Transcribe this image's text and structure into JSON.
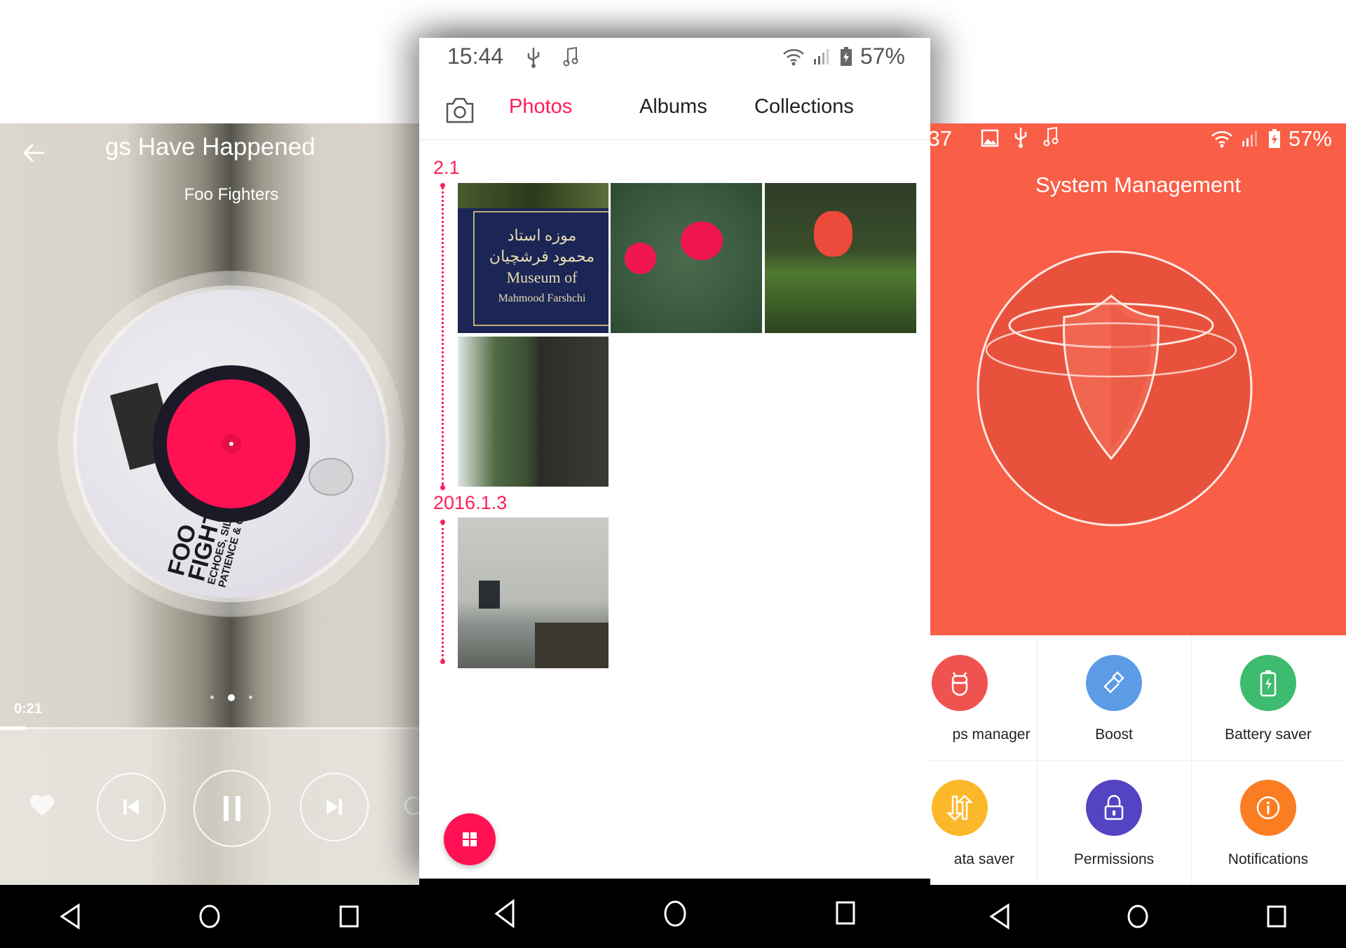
{
  "music_player": {
    "song_title_visible": "gs Have Happened",
    "artist": "Foo Fighters",
    "album_art_text": [
      "FOO",
      "FIGHT",
      "ECHOES, SILEN",
      "PATIENCE & G"
    ],
    "elapsed_time": "0:21",
    "progress_fraction": 0.06,
    "pager": {
      "count": 3,
      "active_index": 1
    },
    "controls": {
      "favorite": "heart-icon",
      "previous": "skip-previous-icon",
      "play_pause": "pause-icon",
      "next": "skip-next-icon",
      "repeat": "repeat-icon"
    },
    "colors": {
      "label": "#ff1153",
      "ring": "#1c1a26"
    }
  },
  "photos_app": {
    "status_bar": {
      "time": "15:44",
      "battery": "57%",
      "left_icons": [
        "usb-icon",
        "music-note-icon"
      ],
      "right_icons": [
        "wifi-icon",
        "signal-icon",
        "battery-charging-icon"
      ]
    },
    "tabs": [
      {
        "label": "Photos",
        "active": true
      },
      {
        "label": "Albums",
        "active": false
      },
      {
        "label": "Collections",
        "active": false
      }
    ],
    "camera_button": "camera-icon",
    "groups": [
      {
        "date": "2.1",
        "photos": [
          {
            "subject": "museum sign",
            "caption_lines": [
              "موزه استاد",
              "محمود فرشچیان",
              "Museum of",
              "Mahmood Farshchi"
            ]
          },
          {
            "subject": "pink flowers"
          },
          {
            "subject": "red rose"
          },
          {
            "subject": "tree trunk"
          }
        ]
      },
      {
        "date": "2016.1.3",
        "photos": [
          {
            "subject": "office room"
          }
        ]
      }
    ],
    "fab_icon": "grid-icon",
    "accent_color": "#ff1d58"
  },
  "system_management": {
    "status_bar": {
      "time": ":37",
      "battery": "57%",
      "left_icons": [
        "image-icon",
        "usb-icon",
        "music-note-icon"
      ],
      "right_icons": [
        "wifi-icon",
        "signal-icon",
        "battery-charging-icon"
      ]
    },
    "title": "System Management",
    "header_color": "#f95e46",
    "tools": [
      {
        "label": "ps manager",
        "icon": "android-icon",
        "color": "#ef5350"
      },
      {
        "label": "Boost",
        "icon": "broom-icon",
        "color": "#5c9ce6"
      },
      {
        "label": "Battery saver",
        "icon": "battery-icon",
        "color": "#3dbb6e"
      },
      {
        "label": "ata saver",
        "icon": "data-transfer-icon",
        "color": "#fbb829"
      },
      {
        "label": "Permissions",
        "icon": "lock-icon",
        "color": "#5443c3"
      },
      {
        "label": "Notifications",
        "icon": "info-icon",
        "color": "#fb7d22"
      }
    ]
  },
  "navigation_bar": {
    "buttons": [
      "back-icon",
      "home-icon",
      "recents-icon"
    ]
  }
}
